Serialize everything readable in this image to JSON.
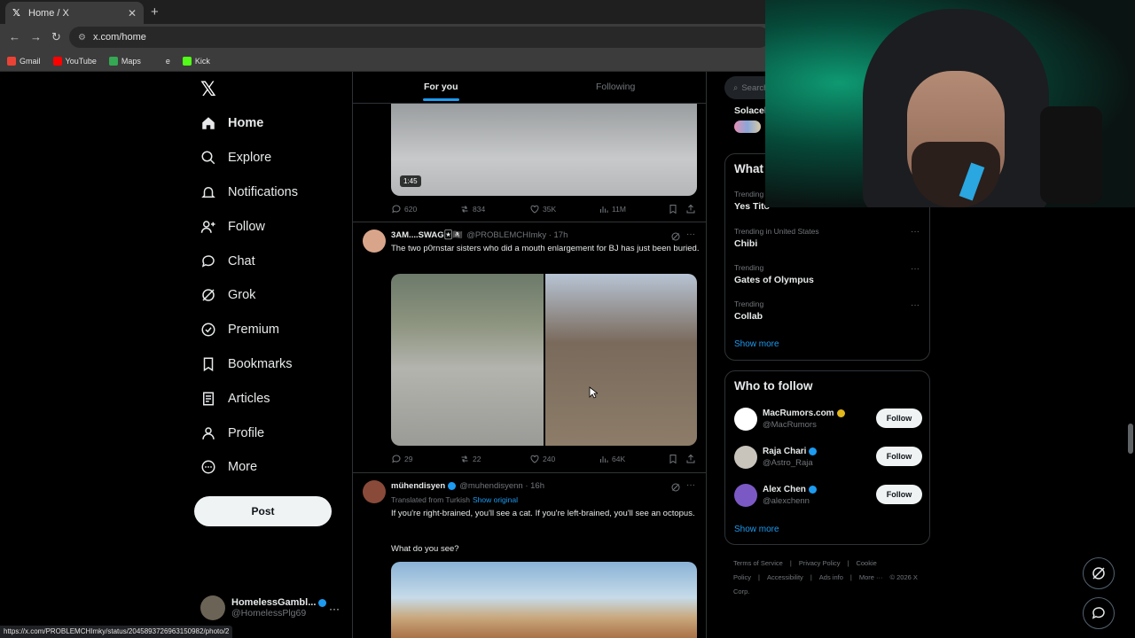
{
  "browser": {
    "tab_title": "Home / X",
    "url": "x.com/home",
    "new_tab": "+",
    "bookmarks": [
      {
        "label": "Gmail",
        "color": "#ea4335"
      },
      {
        "label": "YouTube",
        "color": "#ff0000"
      },
      {
        "label": "Maps",
        "color": "#34a853"
      },
      {
        "label": "e",
        "color": "#3c3c3c"
      },
      {
        "label": "Kick",
        "color": "#53fc18"
      }
    ],
    "status_url": "https://x.com/PROBLEMCHImky/status/2045893726963150982/photo/2"
  },
  "nav": {
    "logo": "𝕏",
    "items": [
      {
        "label": "Home",
        "icon": "home-icon"
      },
      {
        "label": "Explore",
        "icon": "search-icon"
      },
      {
        "label": "Notifications",
        "icon": "bell-icon"
      },
      {
        "label": "Follow",
        "icon": "person-add-icon"
      },
      {
        "label": "Chat",
        "icon": "chat-icon"
      },
      {
        "label": "Grok",
        "icon": "grok-icon"
      },
      {
        "label": "Premium",
        "icon": "premium-icon"
      },
      {
        "label": "Bookmarks",
        "icon": "bookmark-icon"
      },
      {
        "label": "Articles",
        "icon": "article-icon"
      },
      {
        "label": "Profile",
        "icon": "person-icon"
      },
      {
        "label": "More",
        "icon": "more-circle-icon"
      }
    ],
    "post_label": "Post",
    "account": {
      "name": "HomelessGambl...",
      "handle": "@HomelessPlg69",
      "more": "···"
    }
  },
  "feed": {
    "tabs": [
      "For you",
      "Following"
    ],
    "tweet1": {
      "duration": "1:45",
      "replies": "620",
      "reposts": "834",
      "likes": "35K",
      "views": "11M"
    },
    "tweet2": {
      "name": "3AM....SWAG🃏🏴‍☠️",
      "handle": "@PROBLEMCHImky · 17h",
      "text": "The two p0rnstar sisters who did a mouth enlargement for BJ has just been buried.",
      "replies": "29",
      "reposts": "22",
      "likes": "240",
      "views": "64K"
    },
    "tweet3": {
      "name": "mühendisyen",
      "handle": "@muhendisyenn · 16h",
      "translated": "Translated from Turkish",
      "show_original": "Show original",
      "text1": "If you're right-brained, you'll see a cat. If you're left-brained, you'll see an octopus.",
      "text2": "What do you see?"
    },
    "more": "···"
  },
  "right": {
    "search_placeholder": "Search",
    "solace": "Solacel",
    "whats_happening": "What",
    "trends": [
      {
        "meta": "Trending",
        "title": "Yes Tito"
      },
      {
        "meta": "Trending in United States",
        "title": "Chibi"
      },
      {
        "meta": "Trending",
        "title": "Gates of Olympus"
      },
      {
        "meta": "Trending",
        "title": "Collab"
      }
    ],
    "show_more": "Show more",
    "who_to_follow": "Who to follow",
    "follow_suggestions": [
      {
        "name": "MacRumors.com",
        "handle": "@MacRumors",
        "badge": "#e2b719",
        "avatar": "#fff"
      },
      {
        "name": "Raja Chari",
        "handle": "@Astro_Raja",
        "badge": "#1d9bf0",
        "avatar": "#c8c4bc"
      },
      {
        "name": "Alex Chen",
        "handle": "@alexchenn",
        "badge": "#1d9bf0",
        "avatar": "#7b59c4"
      }
    ],
    "follow_label": "Follow",
    "footer": [
      "Terms of Service",
      "|",
      "Privacy Policy",
      "|",
      "Cookie Policy",
      "|",
      "Accessibility",
      "|",
      "Ads info",
      "|",
      "More ···",
      "© 2026 X Corp."
    ]
  },
  "colors": {
    "accent": "#1d9bf0",
    "background": "#000000",
    "border": "#2f3336"
  }
}
